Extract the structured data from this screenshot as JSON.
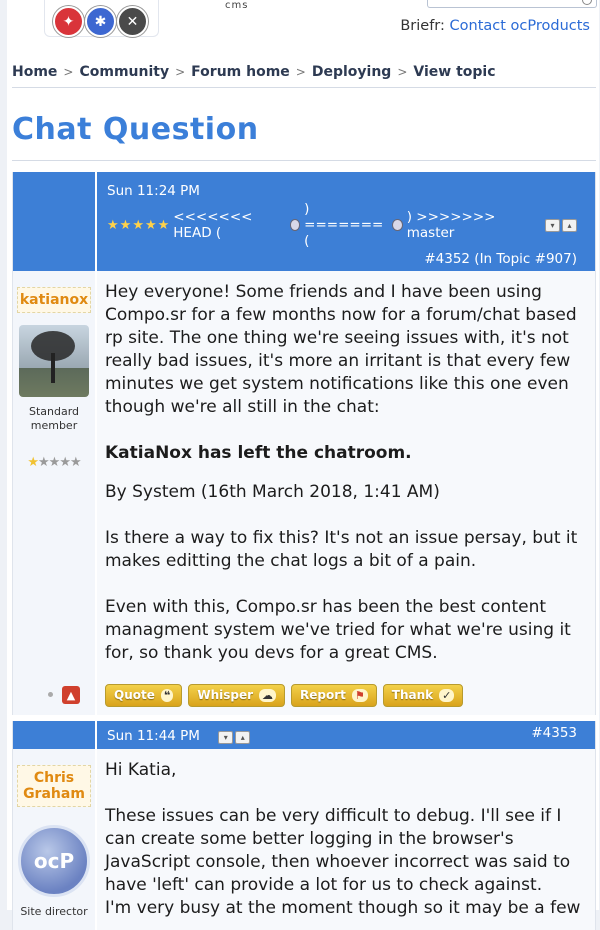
{
  "header": {
    "logo_text": "cms",
    "briefr_label": "Briefr:",
    "briefr_link": "Contact ocProducts"
  },
  "breadcrumb": [
    "Home",
    "Community",
    "Forum home",
    "Deploying",
    "View topic"
  ],
  "breadcrumb_sep": ">",
  "page_title": "Chat Question",
  "posts": [
    {
      "time": "Sun 11:24 PM",
      "merge_text": "<<<<<<< HEAD (",
      "merge_mid": ") ======= (",
      "merge_end": ") >>>>>>> master",
      "post_link": "#4352 (In Topic #907)",
      "author": "katianox",
      "user_title_1": "Standard",
      "user_title_2": "member",
      "body": {
        "p1": "Hey everyone!  Some friends and I have been using Compo.sr for a few months now for a forum/chat based rp site.  The one thing we're seeing issues with, it's not really bad issues, it's more an irritant is that every few minutes we get system notifications like this one even though we're all still in the chat:",
        "chat_note": "KatiaNox has left the chatroom.",
        "p2": "By System (16th March 2018, 1:41 AM)",
        "p3": "Is there a way to fix this?  It's not an issue persay, but it makes editting the chat logs a bit of a pain.",
        "p4": "Even with this, Compo.sr has been the best content managment system we've tried for what we're using it for, so thank you devs for a great CMS."
      }
    },
    {
      "time": "Sun 11:44 PM",
      "post_link": "#4353",
      "author": "Chris Graham",
      "avatar_text": "ocP",
      "user_title_1": "Site director",
      "body": {
        "p1": "Hi Katia,",
        "p2": "These issues can be very difficult to debug. I'll see if I can create some better logging in the browser's JavaScript console, then whoever incorrect was said to have 'left' can provide a lot for us to check against.",
        "p3": "I'm very busy at the moment though so it may be a few"
      }
    }
  ],
  "actions": {
    "quote": "Quote",
    "whisper": "Whisper",
    "report": "Report",
    "thank": "Thank"
  },
  "colors": {
    "accent": "#3d7fd6",
    "author": "#e08a12",
    "button": "#e0b02a"
  }
}
